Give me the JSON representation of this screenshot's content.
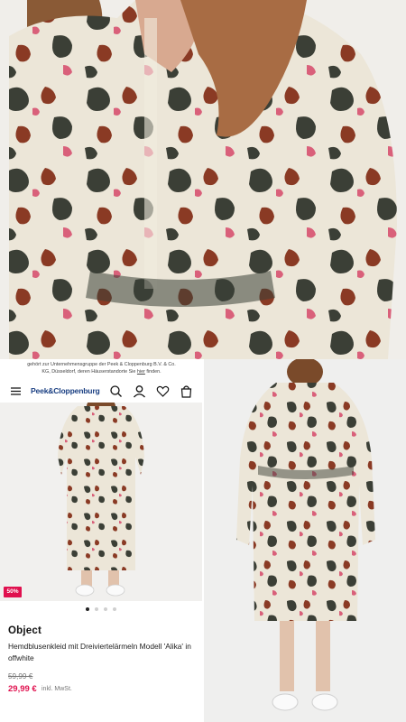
{
  "notice": {
    "line1": "gehört zur Unternehmensgruppe der Peek & Cloppenburg B.V. & Co.",
    "line2": "KG, Düsseldorf, deren Häuserstandorte Sie ",
    "link": "hier",
    "line2_end": " finden."
  },
  "header": {
    "logo": "Peek&Cloppenburg",
    "icons": [
      "menu-icon",
      "search-icon",
      "account-icon",
      "wishlist-icon",
      "bag-icon"
    ]
  },
  "product": {
    "badge": "50%",
    "gallery_dots": 4,
    "gallery_active": 0,
    "brand": "Object",
    "name": "Hemdblusenkleid mit Dreiviertelärmeln Modell 'Alika' in offwhite",
    "old_price": "59,99 €",
    "new_price": "29,99 €",
    "vat": "inkl. MwSt."
  },
  "colors": {
    "brand_blue": "#1a3f82",
    "sale_red": "#e0104e",
    "pattern_cream": "#ece6d8",
    "pattern_dark": "#3b3f36",
    "pattern_rust": "#8a3a24",
    "pattern_pink": "#d9607a"
  }
}
